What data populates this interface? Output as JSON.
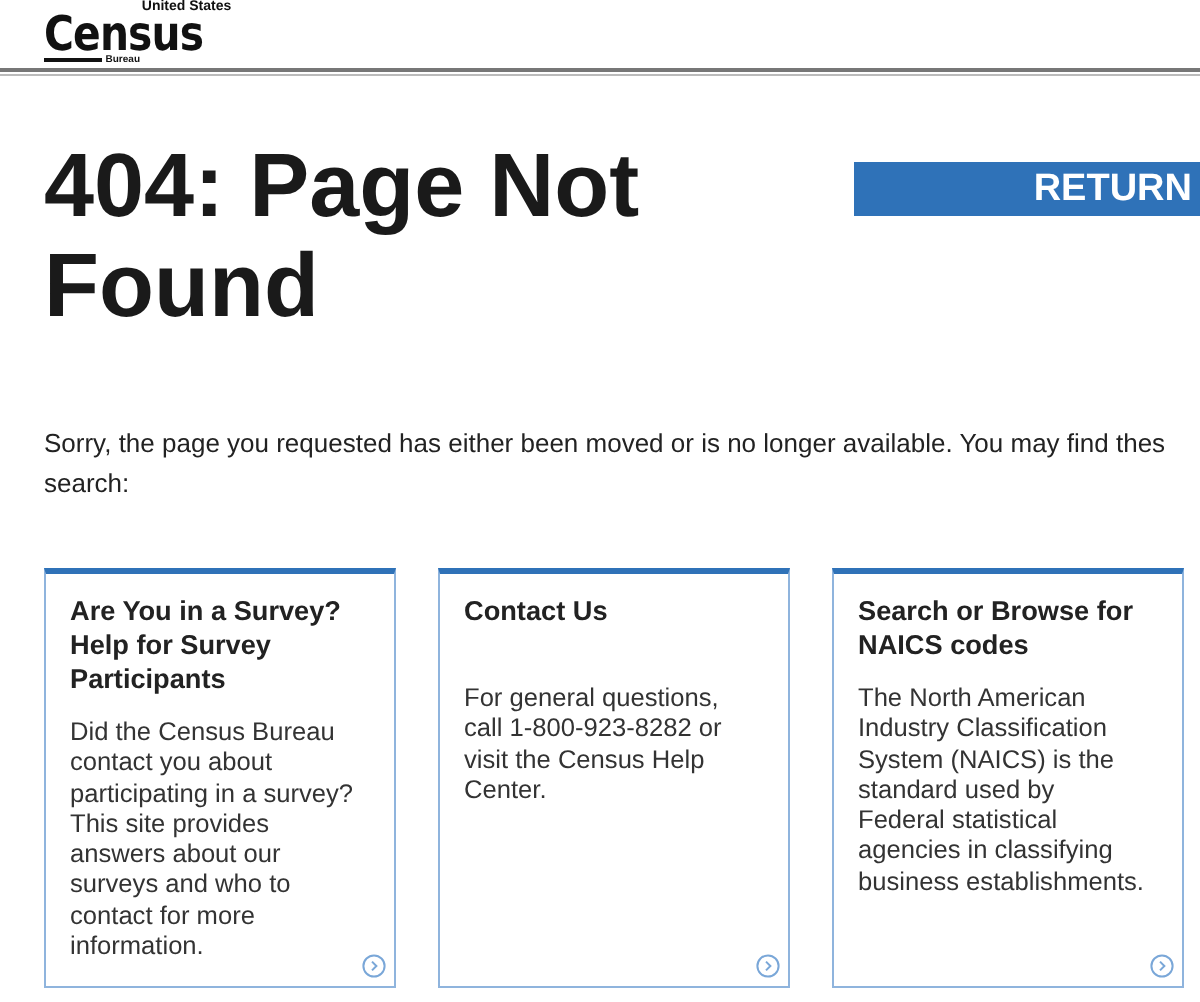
{
  "logo": {
    "top": "United States",
    "name": "Census",
    "sub": "Bureau"
  },
  "heading": "404: Page Not Found",
  "return_button": "RETURN",
  "intro_lines": [
    "Sorry, the page you requested has either been moved or is no longer available. You may find thes",
    "search:"
  ],
  "cards": [
    {
      "title": "Are You in a Survey? Help for Survey Participants",
      "text": "Did the Census Bureau contact you about participating in a survey? This site provides answers about our surveys and who to contact for more information."
    },
    {
      "title": "Contact Us",
      "text": "For general questions, call 1-800-923-8282 or visit the Census Help Center."
    },
    {
      "title": "Search or Browse for NAICS codes",
      "text": "The North American Industry Classification System (NAICS) is the standard used by Federal statistical agencies in classifying business establishments."
    }
  ]
}
